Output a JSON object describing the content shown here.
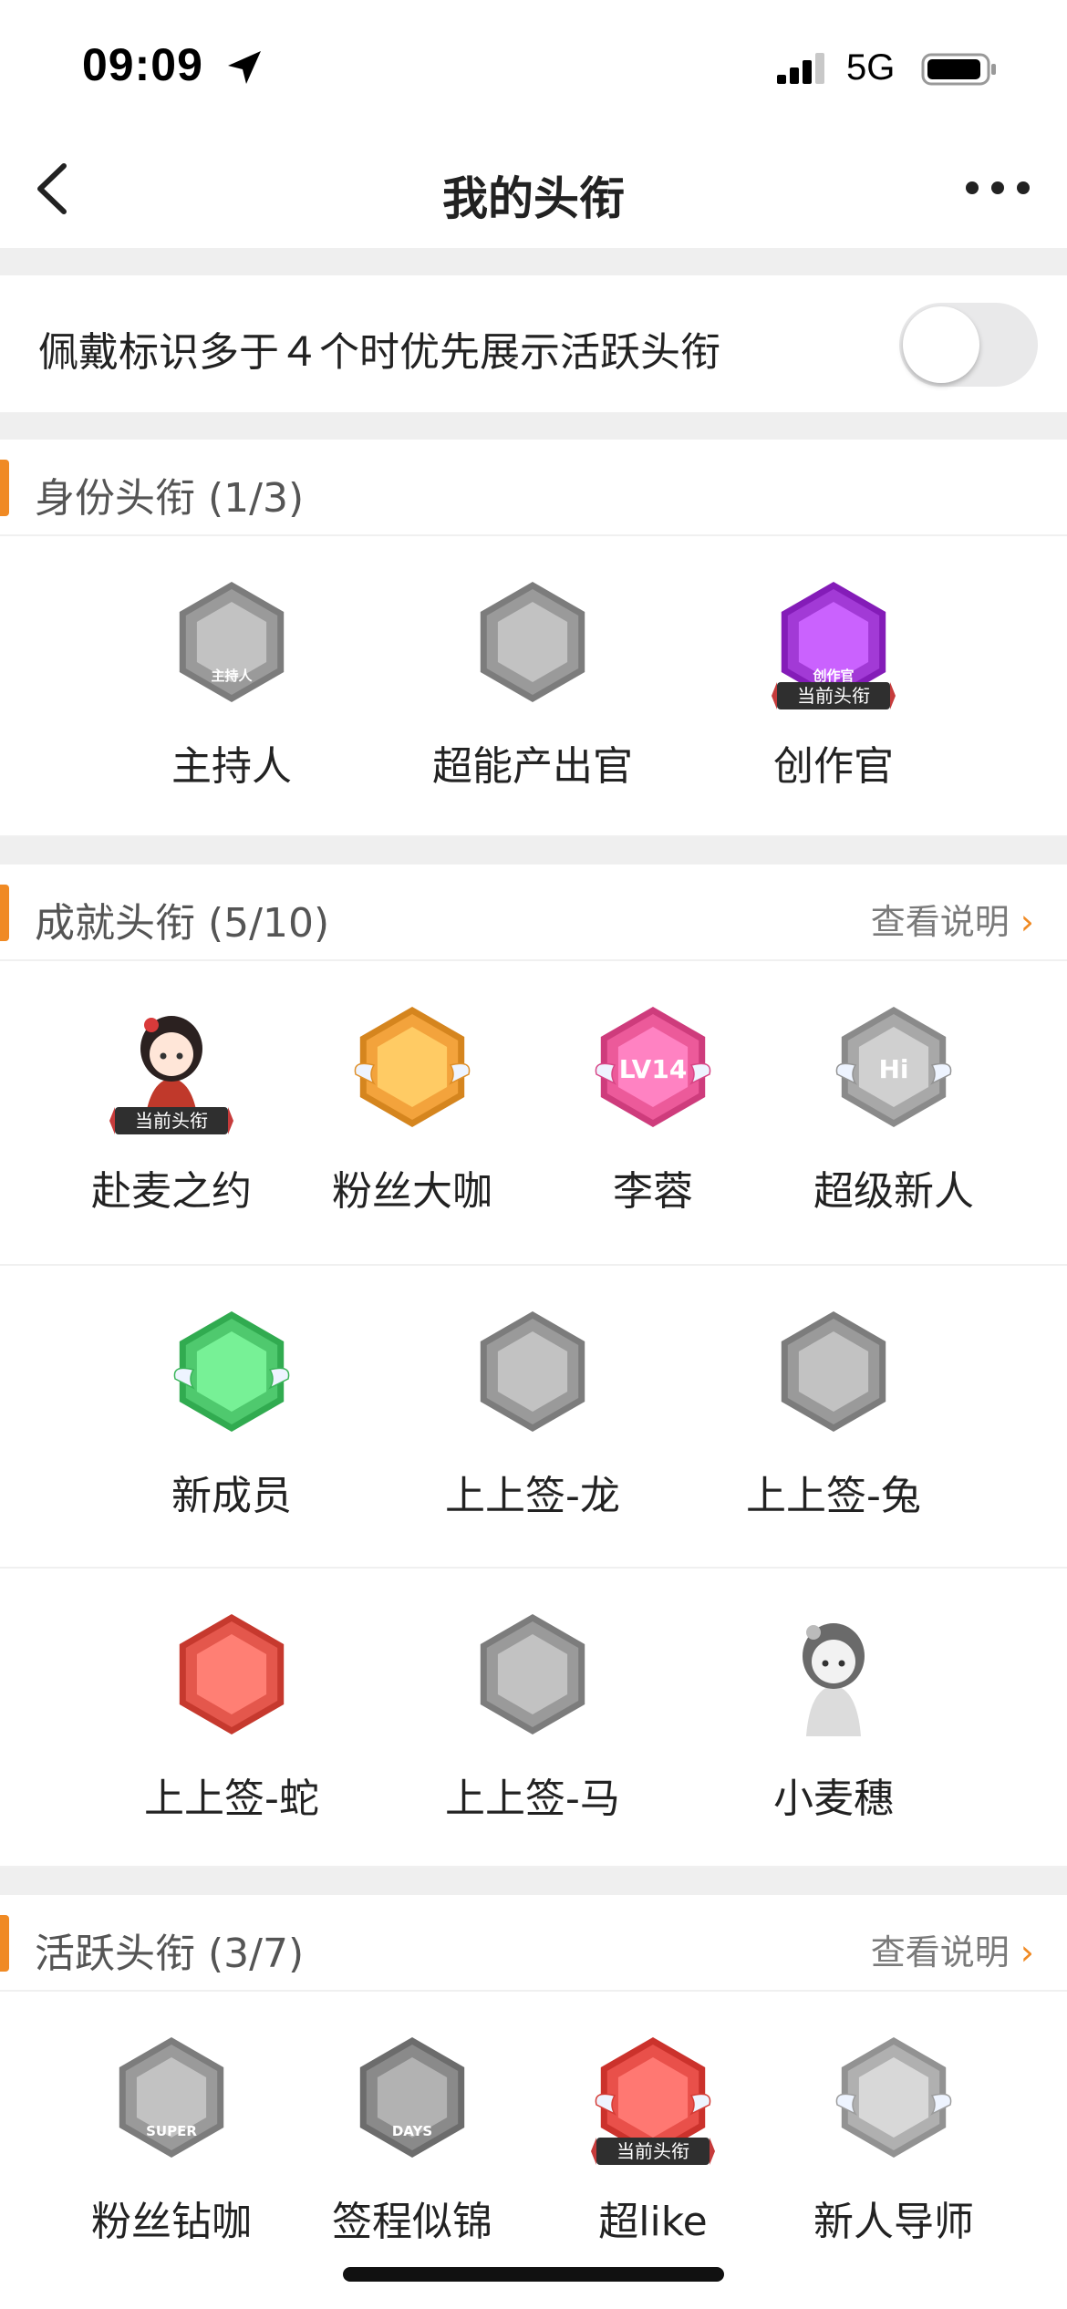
{
  "status_bar": {
    "time": "09:09",
    "network": "5G"
  },
  "nav": {
    "title": "我的头衔",
    "back_icon": "chevron-left-icon",
    "more_icon": "more-dots-icon"
  },
  "toggle": {
    "label": "佩戴标识多于４个时优先展示活跃头衔",
    "on": false
  },
  "current_tag": "当前头衔",
  "sections": {
    "identity": {
      "title": "身份头衔 (1/3)",
      "badges": [
        {
          "label": "主持人",
          "icon": "microphone-badge-icon",
          "active": false,
          "color": "#9a9a9a",
          "mini": "主持人"
        },
        {
          "label": "超能产出官",
          "icon": "cube-badge-icon",
          "active": false,
          "color": "#9a9a9a"
        },
        {
          "label": "创作官",
          "icon": "creator-badge-icon",
          "active": true,
          "current": true,
          "color": "#a23ad6",
          "mini": "创作官"
        }
      ]
    },
    "achievement": {
      "title": "成就头衔 (5/10)",
      "link": "查看说明",
      "rows": [
        [
          {
            "label": "赴麦之约",
            "icon": "girl-avatar-badge-icon",
            "active": true,
            "current": true,
            "color": "#c0392b"
          },
          {
            "label": "粉丝大咖",
            "icon": "crown-badge-icon",
            "active": true,
            "color": "#f3a33c"
          },
          {
            "label": "李蓉",
            "icon": "level-badge-icon",
            "active": true,
            "color": "#ec5a9a",
            "mini": "LV14"
          },
          {
            "label": "超级新人",
            "icon": "hi-badge-icon",
            "active": false,
            "color": "#a8a8a8",
            "mini": "Hi"
          }
        ],
        [
          {
            "label": "新成员",
            "icon": "hand-badge-icon",
            "active": true,
            "color": "#4fc96e"
          },
          {
            "label": "上上签-龙",
            "icon": "dragon-badge-icon",
            "active": false,
            "color": "#9a9a9a"
          },
          {
            "label": "上上签-兔",
            "icon": "rabbit-badge-icon",
            "active": false,
            "color": "#9a9a9a"
          }
        ],
        [
          {
            "label": "上上签-蛇",
            "icon": "snake-badge-icon",
            "active": true,
            "color": "#e4574c"
          },
          {
            "label": "上上签-马",
            "icon": "horse-badge-icon",
            "active": false,
            "color": "#9a9a9a"
          },
          {
            "label": "小麦穗",
            "icon": "princess-badge-icon",
            "active": false,
            "color": "#b5b5b5"
          }
        ]
      ]
    },
    "activity": {
      "title": "活跃头衔 (3/7)",
      "link": "查看说明",
      "badges": [
        {
          "label": "粉丝钻咖",
          "icon": "super-heart-badge-icon",
          "active": false,
          "color": "#9a9a9a",
          "mini": "SUPER"
        },
        {
          "label": "签程似锦",
          "icon": "100-days-badge-icon",
          "active": false,
          "color": "#8a8a8a",
          "mini": "DAYS"
        },
        {
          "label": "超like",
          "icon": "trophy-badge-icon",
          "active": true,
          "current": true,
          "color": "#e9504a"
        },
        {
          "label": "新人导师",
          "icon": "mortarboard-badge-icon",
          "active": false,
          "color": "#b0b0b0"
        }
      ]
    }
  }
}
